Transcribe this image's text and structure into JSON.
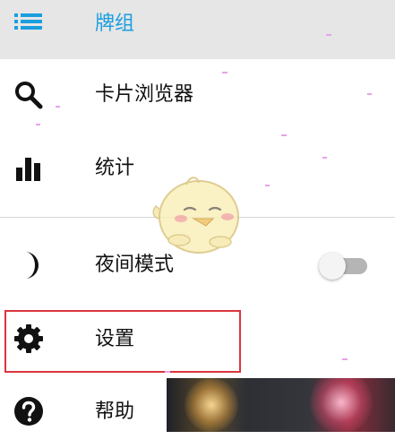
{
  "drawer": {
    "header": {
      "menu_icon": "list-icon",
      "label": "牌组"
    },
    "items": [
      {
        "label": "卡片浏览器",
        "icon": "search-icon"
      },
      {
        "label": "统计",
        "icon": "bar-chart-icon"
      },
      {
        "label": "夜间模式",
        "icon": "moon-icon",
        "toggle_on": false
      },
      {
        "label": "设置",
        "icon": "gear-icon",
        "highlighted": true
      },
      {
        "label": "帮助",
        "icon": "help-circle-icon"
      }
    ]
  },
  "colors": {
    "accent": "#1a9ee0",
    "header_background": "#e6e6e6",
    "highlight_border": "#d9363e",
    "icon": "#111111"
  }
}
